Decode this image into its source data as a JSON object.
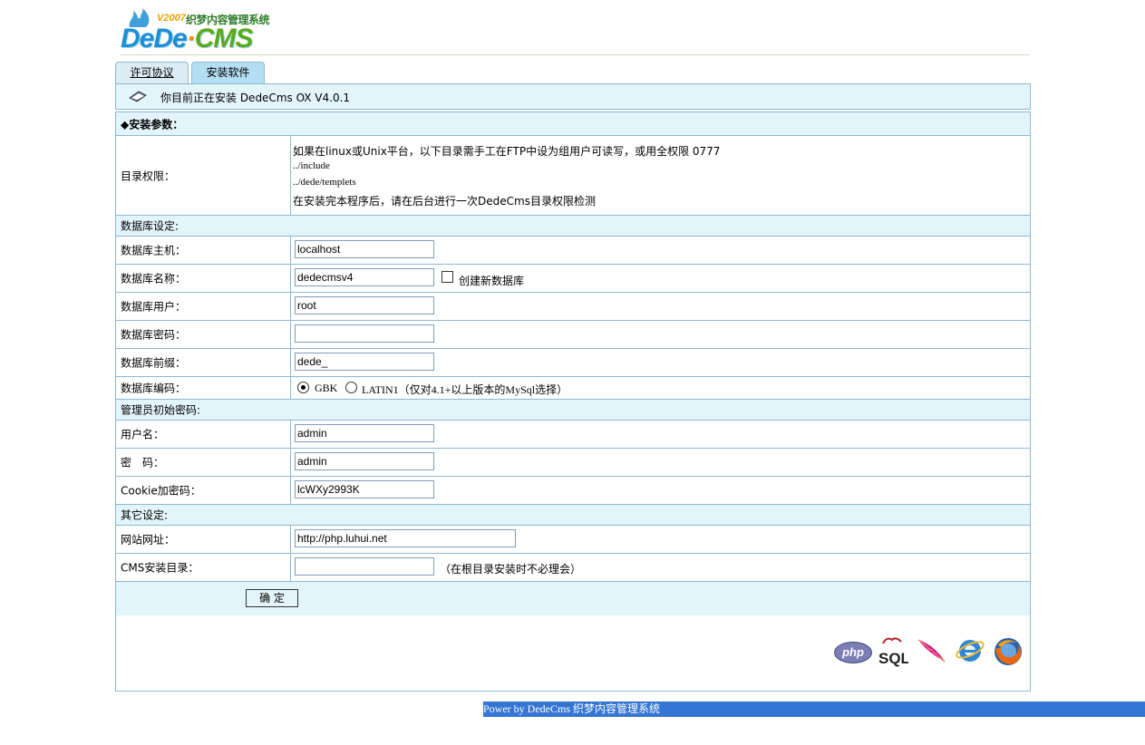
{
  "logo": {
    "version": "V2007",
    "cn_title": "织梦内容管理系统",
    "brand_dede": "DeDe",
    "brand_dot": "·",
    "brand_cms": "CMS"
  },
  "tabs": [
    {
      "label": "许可协议"
    },
    {
      "label": "安装软件"
    }
  ],
  "info": {
    "text": "你目前正在安装 DedeCms OX V4.0.1"
  },
  "sections": {
    "install_params": "◆安装参数：",
    "database": "数据库设定:",
    "admin": "管理员初始密码:",
    "other": "其它设定:"
  },
  "permissions": {
    "label": "目录权限：",
    "line1": "如果在linux或Unix平台，以下目录需手工在FTP中设为组用户可读写，或用全权限 0777",
    "line2": "../include",
    "line3": "../dede/templets",
    "line4": "在安装完本程序后，请在后台进行一次DedeCms目录权限检测"
  },
  "db": {
    "host_label": "数据库主机：",
    "host_value": "localhost",
    "name_label": "数据库名称：",
    "name_value": "dedecmsv4",
    "create_label": "创建新数据库",
    "user_label": "数据库用户：",
    "user_value": "root",
    "pwd_label": "数据库密码：",
    "pwd_value": "",
    "prefix_label": "数据库前缀：",
    "prefix_value": "dede_",
    "charset_label": "数据库编码：",
    "charset_gbk": "GBK",
    "charset_latin": "LATIN1（仅对4.1+以上版本的MySql选择）"
  },
  "admin": {
    "user_label": "用户名：",
    "user_value": "admin",
    "pwd_label": "密　码：",
    "pwd_value": "admin",
    "cookie_label": "Cookie加密码：",
    "cookie_value": "lcWXy2993K"
  },
  "other": {
    "url_label": "网站网址：",
    "url_value": "http://php.luhui.net",
    "dir_label": "CMS安装目录：",
    "dir_value": "",
    "dir_hint": "（在根目录安装时不必理会）"
  },
  "submit": {
    "label": "确 定"
  },
  "tech_icons": [
    "php-icon",
    "mysql-icon",
    "apache-feather-icon",
    "ie-icon",
    "firefox-icon"
  ],
  "tech_text": {
    "php": "php",
    "sql": "SQL"
  },
  "footer": {
    "text": "Power by DedeCms 织梦内容管理系统"
  },
  "colors": {
    "border": "#8cb9d5",
    "light_bg": "#e3f5fb",
    "tab_active": "#b4def2",
    "footer_bg": "#3576d4"
  }
}
